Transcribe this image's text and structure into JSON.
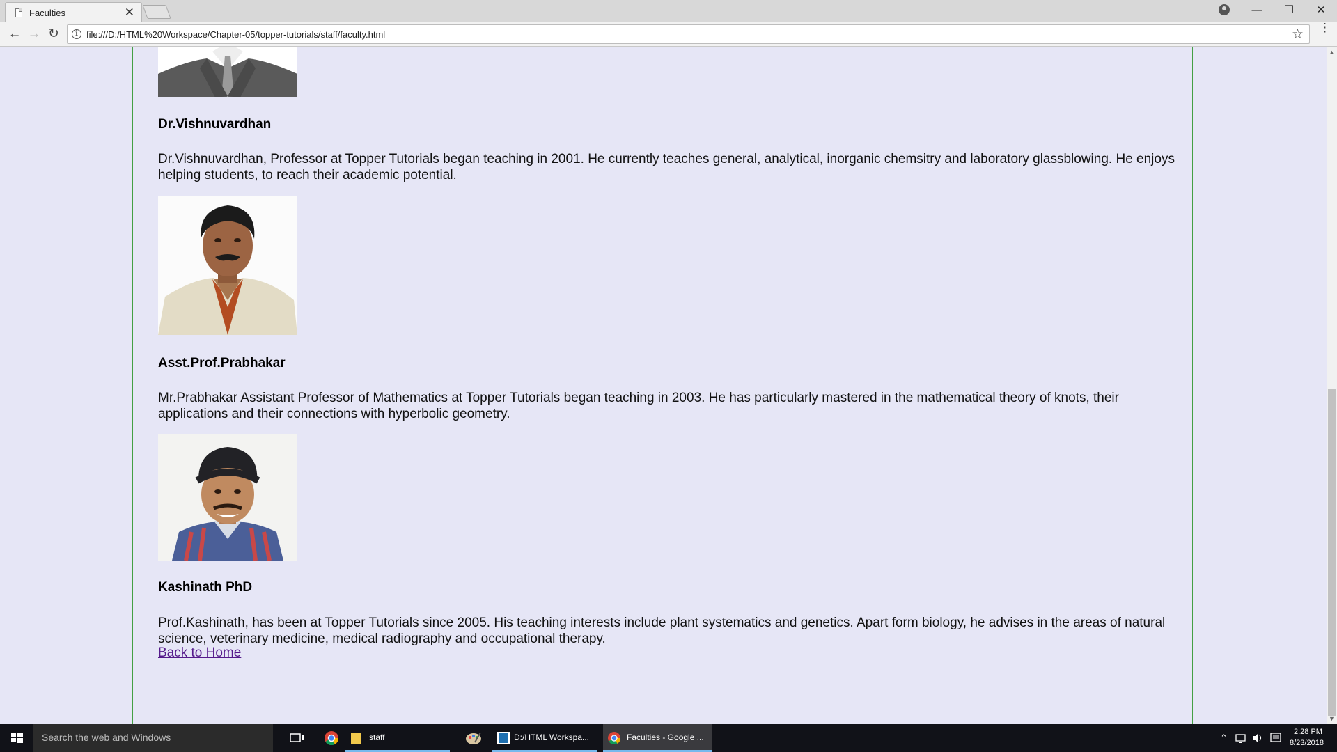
{
  "browser": {
    "tab_title": "Faculties",
    "tab_close": "✕",
    "url": "file:///D:/HTML%20Workspace/Chapter-05/topper-tutorials/staff/faculty.html"
  },
  "faculty": [
    {
      "name": "Dr.Vishnuvardhan",
      "bio": "Dr.Vishnuvardhan, Professor at Topper Tutorials began teaching in 2001. He currently teaches general, analytical, inorganic chemsitry and laboratory glassblowing. He enjoys helping students, to reach their academic potential."
    },
    {
      "name": "Asst.Prof.Prabhakar",
      "bio": "Mr.Prabhakar Assistant Professor of Mathematics at Topper Tutorials began teaching in 2003. He has particularly mastered in the mathematical theory of knots, their applications and their connections with hyperbolic geometry."
    },
    {
      "name": "Kashinath PhD",
      "bio": "Prof.Kashinath, has been at Topper Tutorials since 2005. His teaching interests include plant systematics and genetics. Apart form biology, he advises in the areas of natural science, veterinary medicine, medical radiography and occupational therapy."
    }
  ],
  "back_link": "Back to Home",
  "taskbar": {
    "search_placeholder": "Search the web and Windows",
    "apps": [
      "staff",
      "D:/HTML Workspa...",
      "Faculties - Google ..."
    ],
    "time": "2:28 PM",
    "date": "8/23/2018"
  },
  "colors": {
    "page_background": "#e6e6f6",
    "border": "#44a044",
    "link_visited": "#551a8b",
    "taskbar_accent": "#76b9ed"
  }
}
